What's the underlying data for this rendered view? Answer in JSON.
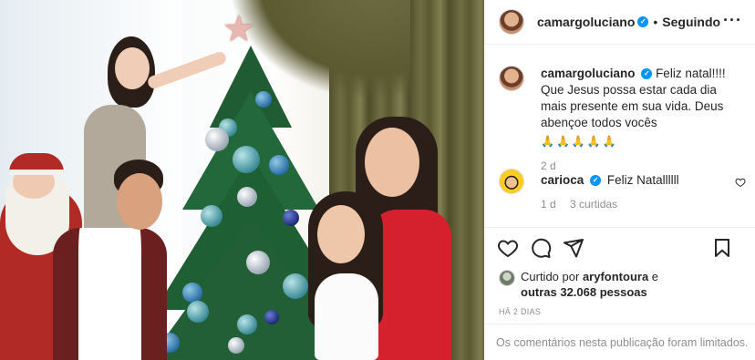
{
  "post": {
    "photo_alt": "",
    "author": {
      "username": "camargoluciano",
      "verified": true,
      "follow_state": "Seguindo",
      "separator": "•"
    },
    "more_icon": "more-horizontal-icon",
    "caption": {
      "username": "camargoluciano",
      "text": "Feliz natal!!!! Que Jesus possa estar cada dia mais presente em sua vida. Deus abençoe todos vocês",
      "emojis": "🙏🙏🙏🙏🙏",
      "age": "2 d"
    },
    "comments": [
      {
        "username": "carioca",
        "verified": true,
        "text": "Feliz Natallllll",
        "age": "1 d",
        "likes_label": "3 curtidas"
      }
    ],
    "actions": {
      "like_icon": "heart-icon",
      "comment_icon": "comment-icon",
      "share_icon": "send-icon",
      "save_icon": "bookmark-icon"
    },
    "likes": {
      "prefix": "Curtido por",
      "first_user": "aryfontoura",
      "conjunction": "e",
      "others": "outras 32.068 pessoas"
    },
    "timestamp": "HÁ 2 DIAS",
    "comments_limited": "Os comentários nesta publicação foram limitados."
  },
  "colors": {
    "verified_blue": "#0095f6",
    "text_primary": "#262626",
    "text_secondary": "#8e8e8e",
    "divider": "#efefef"
  }
}
